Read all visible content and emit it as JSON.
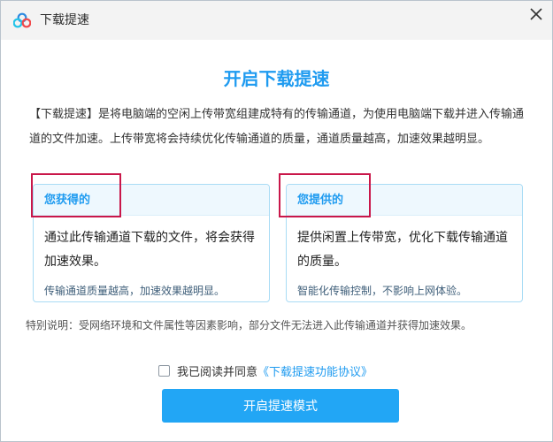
{
  "window": {
    "title": "下载提速",
    "logo_icon": "cloud-logo-icon",
    "close_icon": "close-icon"
  },
  "main": {
    "heading": "开启下载提速",
    "intro": "【下载提速】是将电脑端的空闲上传带宽组建成特有的传输通道，为使用电脑端下载并进入传输通道的文件加速。上传带宽将会持续优化传输通道的质量，通道质量越高，加速效果越明显。"
  },
  "cards": [
    {
      "title": "您获得的",
      "body": "通过此传输通道下载的文件，将会获得加速效果。",
      "note": "传输通道质量越高，加速效果越明显。"
    },
    {
      "title": "您提供的",
      "body": "提供闲置上传带宽，优化下载传输通道的质量。",
      "note": "智能化传输控制，不影响上网体验。"
    }
  ],
  "special_note": "特别说明：受网络环境和文件属性等因素影响，部分文件无法进入此传输通道并获得加速效果。",
  "agreement": {
    "checked": false,
    "label": "我已阅读并同意",
    "link": "《下载提速功能协议》"
  },
  "primary_button": "开启提速模式",
  "colors": {
    "accent": "#1f9bf0",
    "button": "#22a6f5",
    "highlight": "#c9174a",
    "card_border": "#a9dcf5"
  }
}
